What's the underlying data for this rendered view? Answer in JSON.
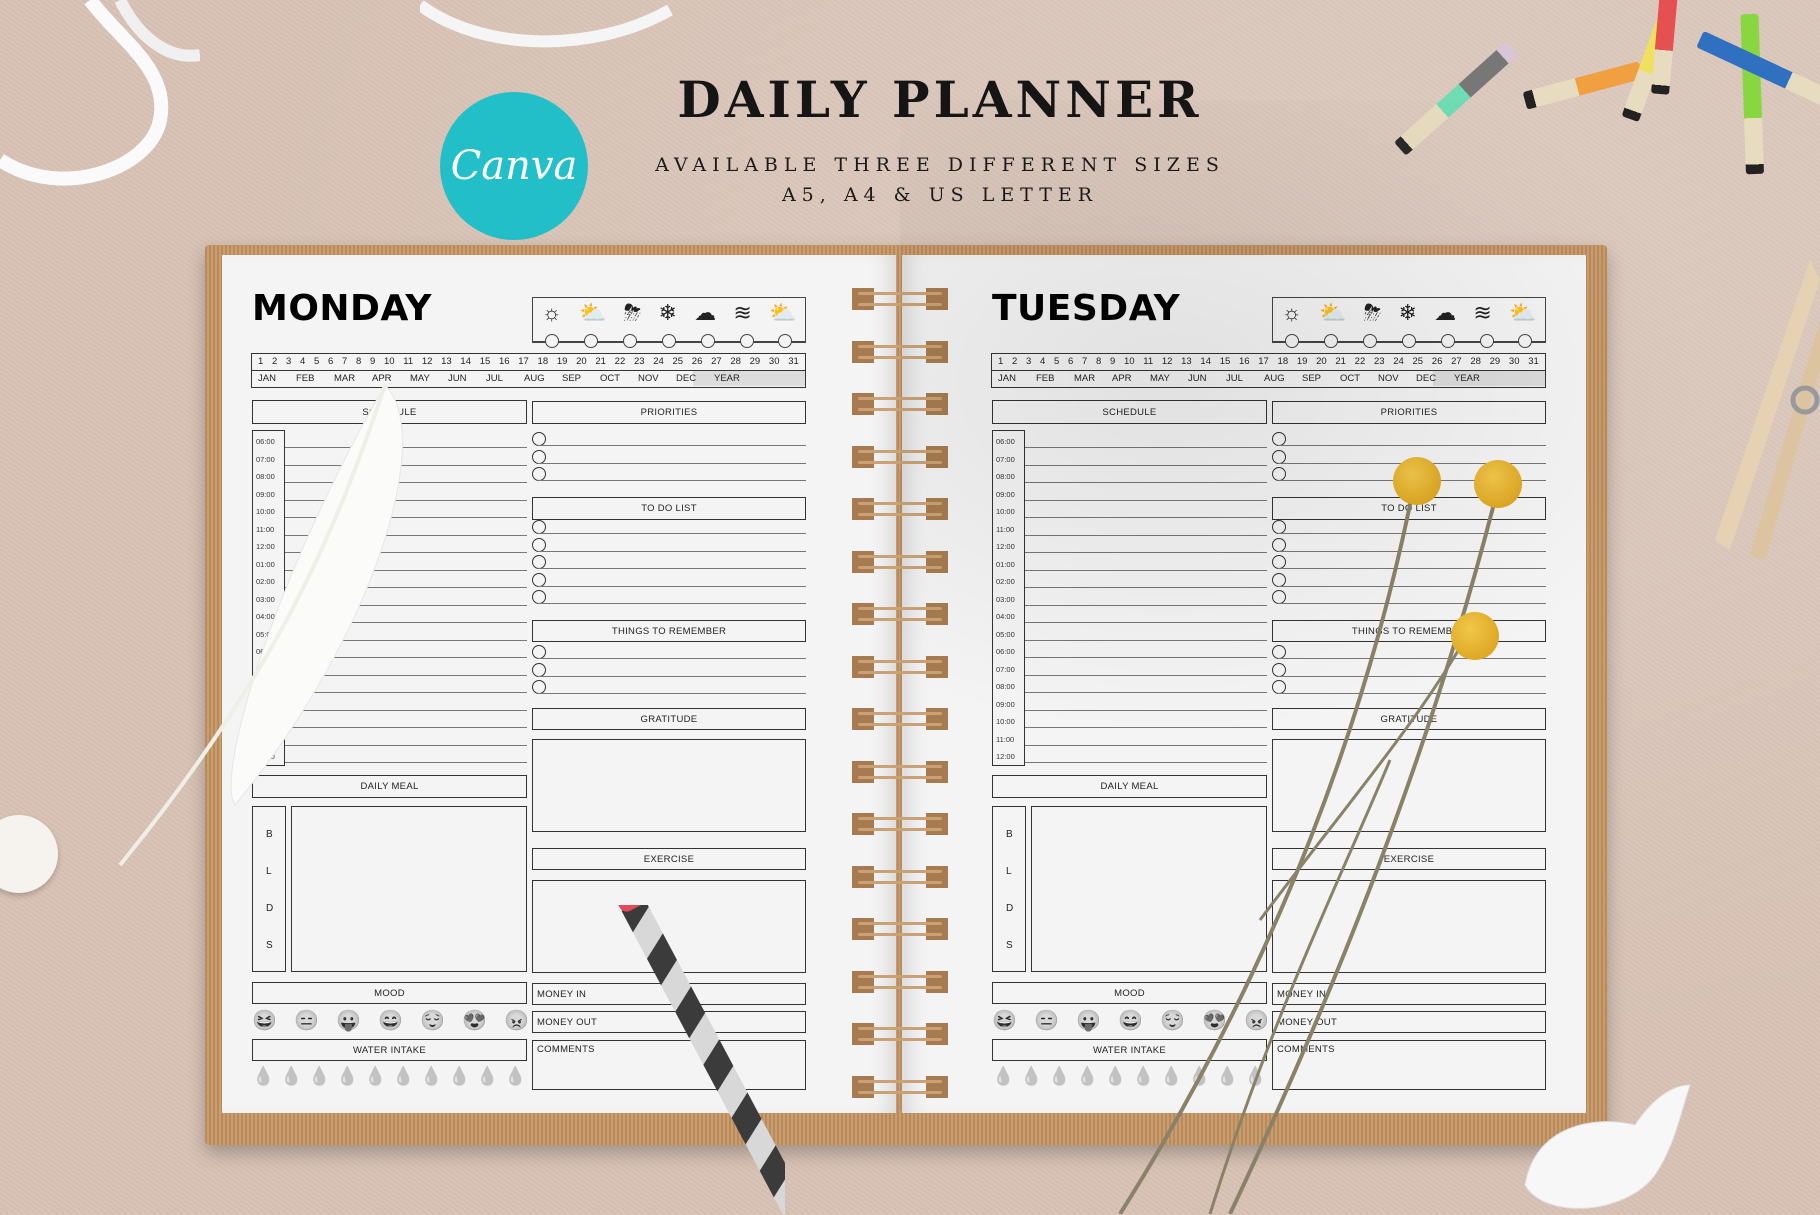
{
  "header": {
    "logo_text": "Canva",
    "title": "DAILY PLANNER",
    "subtitle_line1": "AVAILABLE THREE DIFFERENT SIZES",
    "subtitle_line2": "A5, A4 & US LETTER"
  },
  "weather_icons": [
    "☼",
    "⛅",
    "⛈",
    "❄",
    "☁",
    "≋",
    "⛅"
  ],
  "dates": [
    "1",
    "2",
    "3",
    "4",
    "5",
    "6",
    "7",
    "8",
    "9",
    "10",
    "11",
    "12",
    "13",
    "14",
    "15",
    "16",
    "17",
    "18",
    "19",
    "20",
    "21",
    "22",
    "23",
    "24",
    "25",
    "26",
    "27",
    "28",
    "29",
    "30",
    "31"
  ],
  "months": [
    "JAN",
    "FEB",
    "MAR",
    "APR",
    "MAY",
    "JUN",
    "JUL",
    "AUG",
    "SEP",
    "OCT",
    "NOV",
    "DEC"
  ],
  "year_label": "YEAR",
  "times": [
    "06:00",
    "07:00",
    "08:00",
    "09:00",
    "10:00",
    "11:00",
    "12:00",
    "01:00",
    "02:00",
    "03:00",
    "04:00",
    "05:00",
    "06:00",
    "07:00",
    "08:00",
    "09:00",
    "10:00",
    "11:00",
    "12:00"
  ],
  "labels": {
    "schedule": "SCHEDULE",
    "priorities": "PRIORITIES",
    "todo": "TO DO LIST",
    "remember": "THINGS TO REMEMBER",
    "gratitude": "GRATITUDE",
    "daily_meal": "DAILY MEAL",
    "exercise": "EXERCISE",
    "mood": "MOOD",
    "water": "WATER INTAKE",
    "money_in": "MONEY IN",
    "money_out": "MONEY OUT",
    "comments": "COMMENTS"
  },
  "meal_letters": [
    "B",
    "L",
    "D",
    "S"
  ],
  "moods": [
    "😆",
    "😑",
    "😛",
    "😄",
    "😌",
    "😍",
    "😠"
  ],
  "water_drop_count": 10,
  "water_drop_glyph": "💧",
  "pages": [
    {
      "day": "MONDAY"
    },
    {
      "day": "TUESDAY"
    }
  ]
}
